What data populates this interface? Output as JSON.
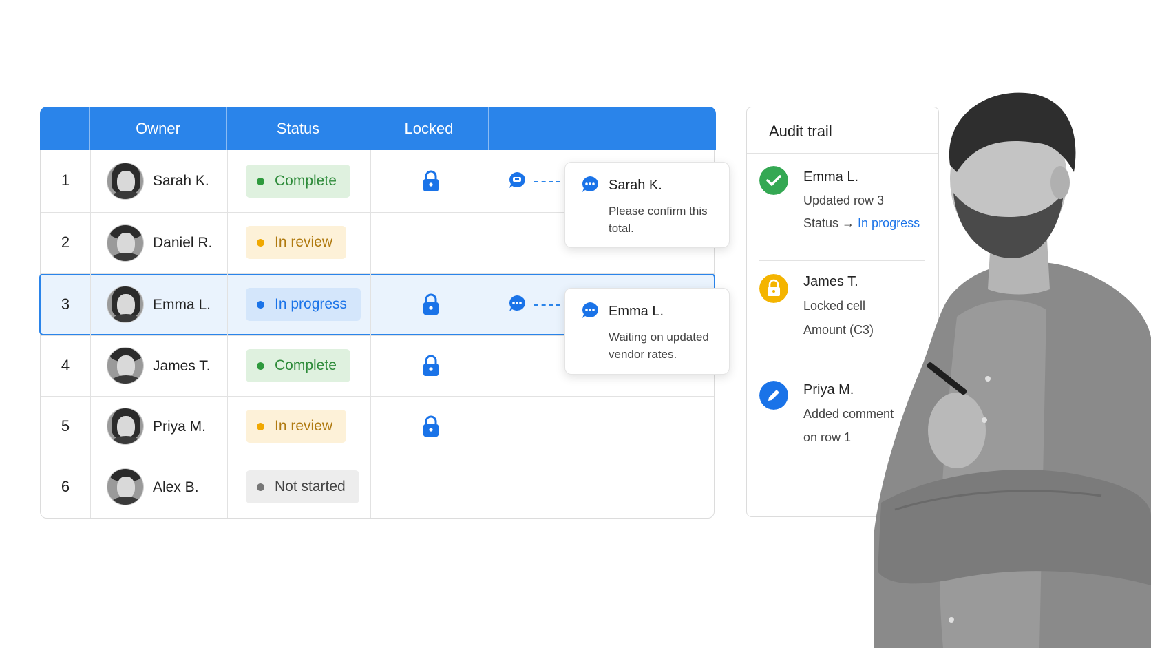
{
  "table": {
    "headers": {
      "owner": "Owner",
      "status": "Status",
      "locked": "Locked"
    },
    "rows": [
      {
        "num": "1",
        "owner": "Sarah K.",
        "status": "Complete",
        "status_type": "complete",
        "locked": true,
        "comment": true
      },
      {
        "num": "2",
        "owner": "Daniel R.",
        "status": "In review",
        "status_type": "review",
        "locked": false,
        "comment": false
      },
      {
        "num": "3",
        "owner": "Emma L.",
        "status": "In progress",
        "status_type": "progress",
        "locked": true,
        "comment": true,
        "selected": true
      },
      {
        "num": "4",
        "owner": "James T.",
        "status": "Complete",
        "status_type": "complete",
        "locked": true,
        "comment": false
      },
      {
        "num": "5",
        "owner": "Priya M.",
        "status": "In review",
        "status_type": "review",
        "locked": true,
        "comment": false
      },
      {
        "num": "6",
        "owner": "Alex B.",
        "status": "Not started",
        "status_type": "notstarted",
        "locked": false,
        "comment": false
      }
    ]
  },
  "comments": [
    {
      "name": "Sarah K.",
      "text": "Please confirm this total."
    },
    {
      "name": "Emma L.",
      "text": "Waiting on updated vendor rates."
    }
  ],
  "audit": {
    "title": "Audit trail",
    "entries": [
      {
        "icon": "check-icon",
        "name": "Emma L.",
        "line1": "Updated row 3",
        "line2_prefix": "Status →",
        "line2_value": "In progress"
      },
      {
        "icon": "lock-icon",
        "name": "James T.",
        "line1": "Locked cell",
        "line2": "Amount (C3)"
      },
      {
        "icon": "pencil-icon",
        "name": "Priya M.",
        "line1": "Added comment",
        "line2": "on row 1"
      }
    ]
  },
  "colors": {
    "accent": "#2a84ea",
    "complete": "#2e9a3d",
    "review": "#f0a800",
    "progress": "#1a73e8",
    "not_started": "#777777"
  }
}
